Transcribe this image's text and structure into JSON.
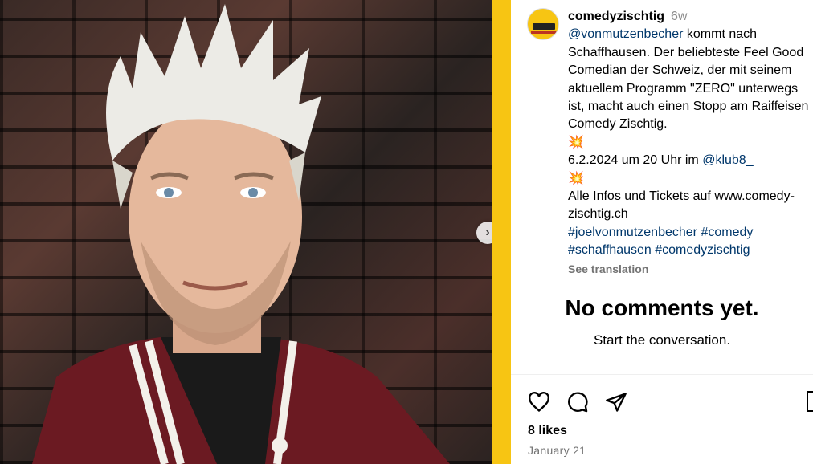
{
  "post": {
    "username": "comedyzischtig",
    "time_ago": "6w",
    "caption_lines": [
      {
        "mention": "@vonmutzenbecher",
        "text": " kommt nach"
      },
      {
        "text": "Schaffhausen. Der beliebteste Feel Good"
      },
      {
        "text": "Comedian der Schweiz, der mit seinem"
      },
      {
        "text": "aktuellem Programm \"ZERO\" unterwegs"
      },
      {
        "text": "ist, macht auch einen Stopp am Raiffeisen"
      },
      {
        "text": "Comedy Zischtig."
      }
    ],
    "emoji": "💥",
    "event_text": "6.2.2024 um 20 Uhr im ",
    "event_mention": "@klub8_",
    "info_line1": "Alle Infos und Tickets auf www.comedy-",
    "info_line2": "zischtig.ch",
    "hashtags_line1": "#joelvonmutzenbecher #comedy",
    "hashtags_line2": "#schaffhausen #comedyzischtig",
    "see_translation": "See translation"
  },
  "comments": {
    "empty_title": "No comments yet.",
    "empty_subtitle": "Start the conversation."
  },
  "footer": {
    "likes": "8 likes",
    "date": "January 21"
  },
  "icons": {
    "like": "heart-icon",
    "comment": "comment-icon",
    "share": "share-icon",
    "save": "bookmark-icon",
    "next": "chevron-right-icon"
  },
  "colors": {
    "accent_yellow": "#f7c513",
    "link_blue": "#00376b",
    "muted_gray": "#737373"
  }
}
